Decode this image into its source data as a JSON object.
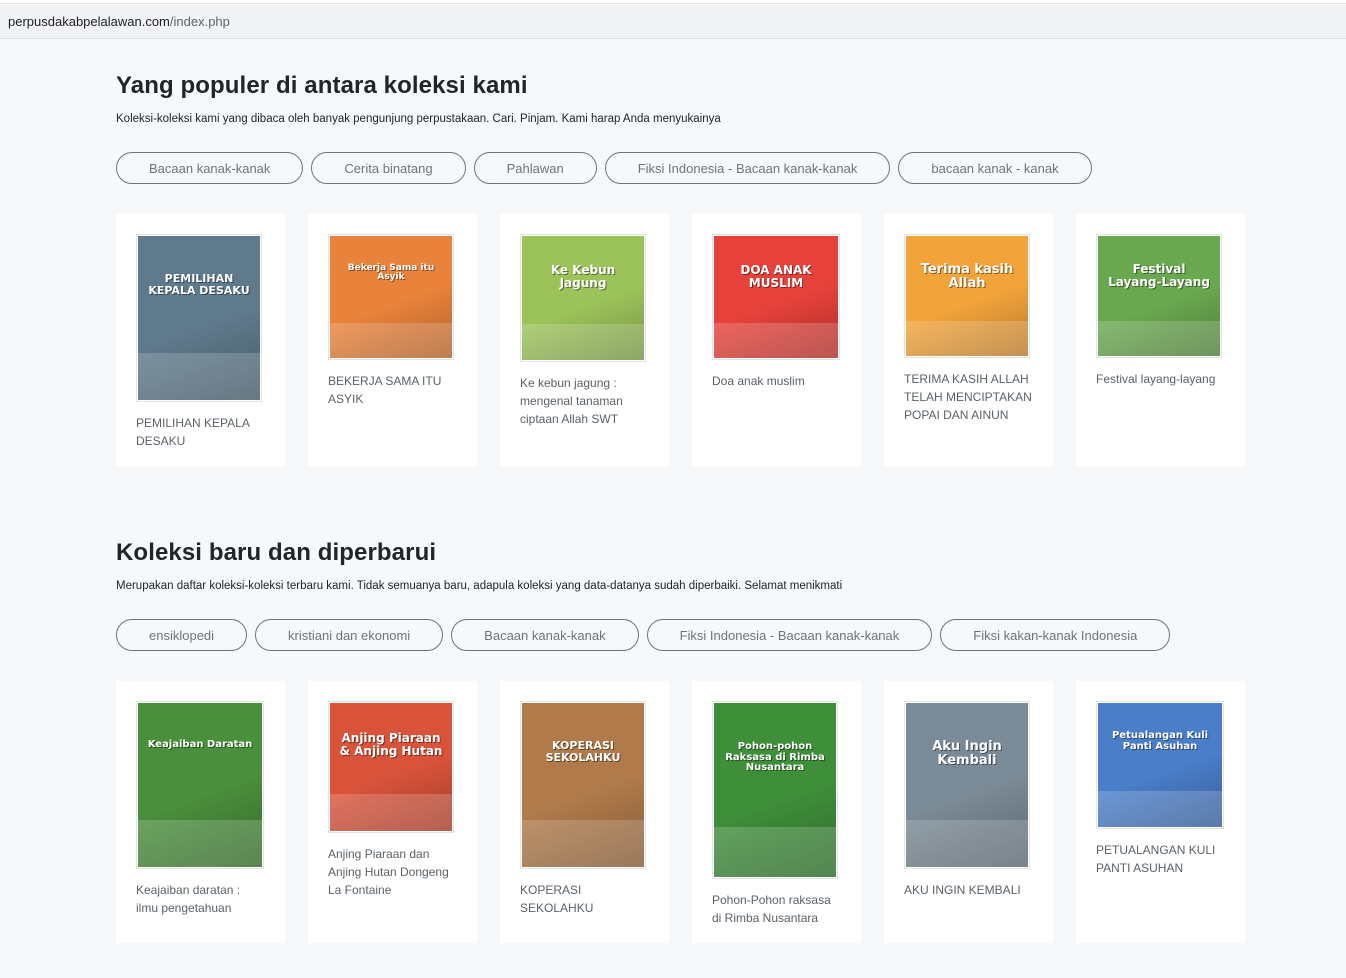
{
  "browser": {
    "url_domain": "perpusdakabpelalawan.com",
    "url_path": "/index.php"
  },
  "popular": {
    "title": "Yang populer di antara koleksi kami",
    "description": "Koleksi-koleksi kami yang dibaca oleh banyak pengunjung perpustakaan. Cari. Pinjam. Kami harap Anda menyukainya",
    "tags": [
      "Bacaan kanak-kanak",
      "Cerita binatang",
      "Pahlawan",
      "Fiksi Indonesia - Bacaan kanak-kanak",
      "bacaan kanak - kanak"
    ],
    "books": [
      {
        "title": "PEMILIHAN KEPALA DESAKU",
        "cover_text": "PEMILIHAN KEPALA DESAKU",
        "cover_color": "#5f7a8c"
      },
      {
        "title": "BEKERJA SAMA ITU ASYIK",
        "cover_text": "Bekerja Sama itu Asyik",
        "cover_color": "#e9823a"
      },
      {
        "title": "Ke kebun jagung : mengenal tanaman ciptaan Allah SWT",
        "cover_text": "Ke Kebun Jagung",
        "cover_color": "#9cc35a"
      },
      {
        "title": "Doa anak muslim",
        "cover_text": "DOA ANAK MUSLIM",
        "cover_color": "#e6413a"
      },
      {
        "title": "TERIMA KASIH ALLAH TELAH MENCIPTAKAN POPAI DAN AINUN",
        "cover_text": "Terima kasih Allah",
        "cover_color": "#f2a33a"
      },
      {
        "title": "Festival layang-layang",
        "cover_text": "Festival Layang-Layang",
        "cover_color": "#6aa84f"
      }
    ]
  },
  "latest": {
    "title": "Koleksi baru dan diperbarui",
    "description": "Merupakan daftar koleksi-koleksi terbaru kami. Tidak semuanya baru, adapula koleksi yang data-datanya sudah diperbaiki. Selamat menikmati",
    "tags": [
      "ensiklopedi",
      "kristiani dan ekonomi",
      "Bacaan kanak-kanak",
      "Fiksi Indonesia - Bacaan kanak-kanak",
      "Fiksi kakan-kanak Indonesia"
    ],
    "books": [
      {
        "title": "Keajaiban daratan : ilmu pengetahuan",
        "cover_text": "Keajaiban Daratan",
        "cover_color": "#4a8f3c"
      },
      {
        "title": "Anjing Piaraan dan Anjing Hutan Dongeng La Fontaine",
        "cover_text": "Anjing Piaraan & Anjing Hutan",
        "cover_color": "#d9533a"
      },
      {
        "title": "KOPERASI SEKOLAHKU",
        "cover_text": "KOPERASI SEKOLAHKU",
        "cover_color": "#b07a4a"
      },
      {
        "title": "Pohon-Pohon raksasa di Rimba Nusantara",
        "cover_text": "Pohon-pohon Raksasa di Rimba Nusantara",
        "cover_color": "#3f8f3a"
      },
      {
        "title": "AKU INGIN KEMBALI",
        "cover_text": "Aku Ingin Kembali",
        "cover_color": "#7a8a96"
      },
      {
        "title": "PETUALANGAN KULI PANTI ASUHAN",
        "cover_text": "Petualangan Kuli Panti Asuhan",
        "cover_color": "#4a7ec9"
      }
    ]
  }
}
